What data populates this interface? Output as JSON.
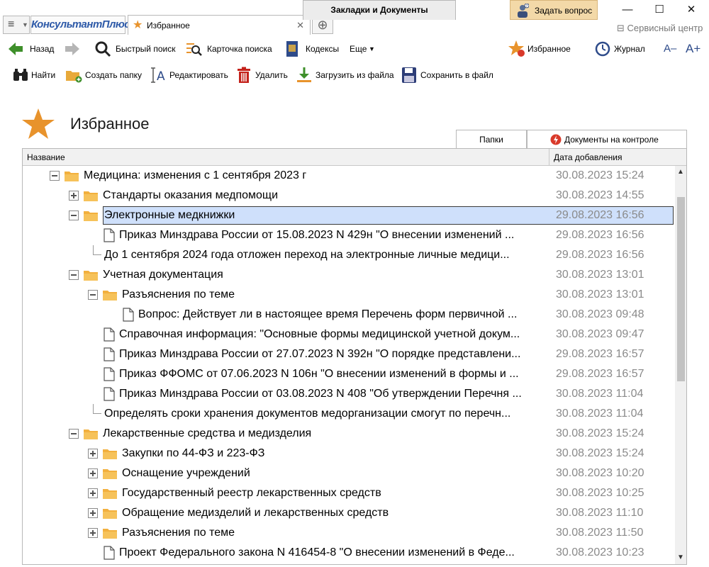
{
  "titlebar": {
    "brand": "КонсультантПлюс",
    "tab_title": "Избранное",
    "ask_button": "Задать вопрос",
    "service_center": "Сервисный центр",
    "minimize": "—",
    "maximize": "☐",
    "close": "✕"
  },
  "toolbar": {
    "back": "Назад",
    "quick_search": "Быстрый поиск",
    "search_card": "Карточка поиска",
    "codes": "Кодексы",
    "more": "Еще",
    "favorites": "Избранное",
    "journal": "Журнал",
    "font_smaller": "A–",
    "font_larger": "A+"
  },
  "actions": {
    "find": "Найти",
    "create_folder": "Создать папку",
    "edit": "Редактировать",
    "delete": "Удалить",
    "load_from_file": "Загрузить из файла",
    "save_to_file": "Сохранить в файл"
  },
  "page": {
    "title": "Избранное",
    "tabs": [
      {
        "label": "Закладки и Документы"
      },
      {
        "label": "Папки"
      },
      {
        "label": "Документы на контроле"
      }
    ]
  },
  "grid": {
    "col_name": "Название",
    "col_date": "Дата добавления",
    "rows": [
      {
        "label": "Медицина: изменения с 1 сентября 2023 г",
        "date": "30.08.2023 15:24"
      },
      {
        "label": "Стандарты оказания медпомощи",
        "date": "30.08.2023 14:55"
      },
      {
        "label": "Электронные медкнижки",
        "date": "29.08.2023 16:56"
      },
      {
        "label": "Приказ Минздрава России от 15.08.2023 N 429н \"О внесении изменений ...",
        "date": "29.08.2023 16:56"
      },
      {
        "label": "До 1 сентября 2024 года отложен переход на электронные личные медици...",
        "date": "29.08.2023 16:56"
      },
      {
        "label": "Учетная документация",
        "date": "30.08.2023 13:01"
      },
      {
        "label": "Разъяснения по теме",
        "date": "30.08.2023 13:01"
      },
      {
        "label": "Вопрос: Действует ли в настоящее время Перечень форм первичной ...",
        "date": "30.08.2023 09:48"
      },
      {
        "label": "Справочная информация: \"Основные формы медицинской учетной докум...",
        "date": "30.08.2023 09:47"
      },
      {
        "label": "Приказ Минздрава России от 27.07.2023 N 392н \"О порядке представлени...",
        "date": "29.08.2023 16:57"
      },
      {
        "label": "Приказ ФФОМС от 07.06.2023 N 106н \"О внесении изменений в формы и ...",
        "date": "29.08.2023 16:57"
      },
      {
        "label": "Приказ Минздрава России от 03.08.2023 N 408 \"Об утверждении Перечня ...",
        "date": "30.08.2023 11:04"
      },
      {
        "label": "Определять сроки хранения документов медорганизации смогут по перечн...",
        "date": "30.08.2023 11:04"
      },
      {
        "label": "Лекарственные средства и медизделия",
        "date": "30.08.2023 15:24"
      },
      {
        "label": "Закупки по 44-ФЗ и 223-ФЗ",
        "date": "30.08.2023 15:24"
      },
      {
        "label": "Оснащение учреждений",
        "date": "30.08.2023 10:20"
      },
      {
        "label": "Государственный реестр лекарственных средств",
        "date": "30.08.2023 10:25"
      },
      {
        "label": "Обращение медизделий и лекарственных средств",
        "date": "30.08.2023 11:10"
      },
      {
        "label": "Разъяснения по теме",
        "date": "30.08.2023 11:50"
      },
      {
        "label": "Проект Федерального закона N 416454-8 \"О внесении изменений в Феде...",
        "date": "30.08.2023 10:23"
      }
    ]
  },
  "colors": {
    "accent_orange": "#e8932c",
    "selection": "#cfe0fb",
    "ask_button_bg": "#f3d9a8",
    "brand_blue": "#2e5aa8"
  }
}
